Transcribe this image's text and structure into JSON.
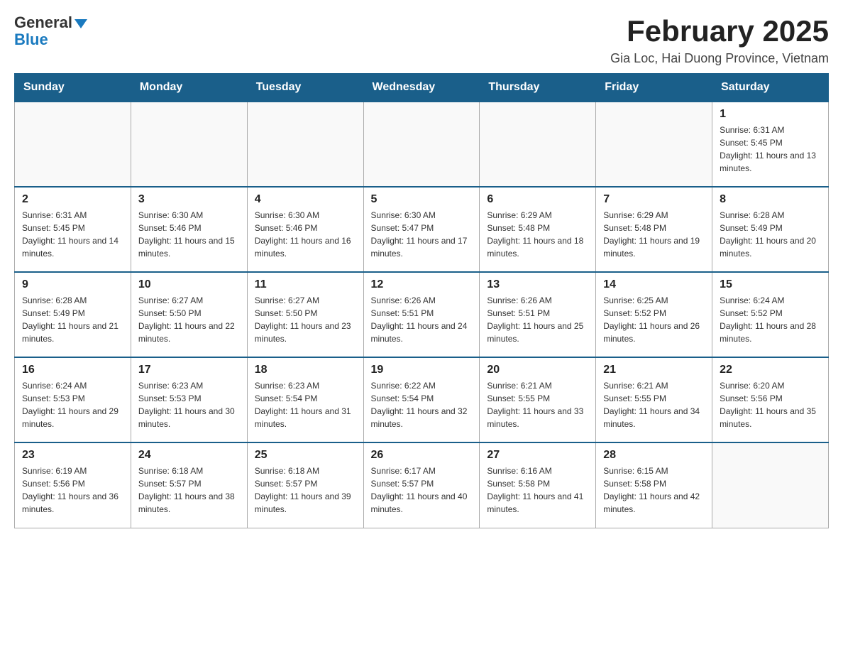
{
  "header": {
    "logo_general": "General",
    "logo_blue": "Blue",
    "month_title": "February 2025",
    "location": "Gia Loc, Hai Duong Province, Vietnam"
  },
  "weekdays": [
    "Sunday",
    "Monday",
    "Tuesday",
    "Wednesday",
    "Thursday",
    "Friday",
    "Saturday"
  ],
  "weeks": [
    [
      {
        "day": "",
        "sunrise": "",
        "sunset": "",
        "daylight": ""
      },
      {
        "day": "",
        "sunrise": "",
        "sunset": "",
        "daylight": ""
      },
      {
        "day": "",
        "sunrise": "",
        "sunset": "",
        "daylight": ""
      },
      {
        "day": "",
        "sunrise": "",
        "sunset": "",
        "daylight": ""
      },
      {
        "day": "",
        "sunrise": "",
        "sunset": "",
        "daylight": ""
      },
      {
        "day": "",
        "sunrise": "",
        "sunset": "",
        "daylight": ""
      },
      {
        "day": "1",
        "sunrise": "Sunrise: 6:31 AM",
        "sunset": "Sunset: 5:45 PM",
        "daylight": "Daylight: 11 hours and 13 minutes."
      }
    ],
    [
      {
        "day": "2",
        "sunrise": "Sunrise: 6:31 AM",
        "sunset": "Sunset: 5:45 PM",
        "daylight": "Daylight: 11 hours and 14 minutes."
      },
      {
        "day": "3",
        "sunrise": "Sunrise: 6:30 AM",
        "sunset": "Sunset: 5:46 PM",
        "daylight": "Daylight: 11 hours and 15 minutes."
      },
      {
        "day": "4",
        "sunrise": "Sunrise: 6:30 AM",
        "sunset": "Sunset: 5:46 PM",
        "daylight": "Daylight: 11 hours and 16 minutes."
      },
      {
        "day": "5",
        "sunrise": "Sunrise: 6:30 AM",
        "sunset": "Sunset: 5:47 PM",
        "daylight": "Daylight: 11 hours and 17 minutes."
      },
      {
        "day": "6",
        "sunrise": "Sunrise: 6:29 AM",
        "sunset": "Sunset: 5:48 PM",
        "daylight": "Daylight: 11 hours and 18 minutes."
      },
      {
        "day": "7",
        "sunrise": "Sunrise: 6:29 AM",
        "sunset": "Sunset: 5:48 PM",
        "daylight": "Daylight: 11 hours and 19 minutes."
      },
      {
        "day": "8",
        "sunrise": "Sunrise: 6:28 AM",
        "sunset": "Sunset: 5:49 PM",
        "daylight": "Daylight: 11 hours and 20 minutes."
      }
    ],
    [
      {
        "day": "9",
        "sunrise": "Sunrise: 6:28 AM",
        "sunset": "Sunset: 5:49 PM",
        "daylight": "Daylight: 11 hours and 21 minutes."
      },
      {
        "day": "10",
        "sunrise": "Sunrise: 6:27 AM",
        "sunset": "Sunset: 5:50 PM",
        "daylight": "Daylight: 11 hours and 22 minutes."
      },
      {
        "day": "11",
        "sunrise": "Sunrise: 6:27 AM",
        "sunset": "Sunset: 5:50 PM",
        "daylight": "Daylight: 11 hours and 23 minutes."
      },
      {
        "day": "12",
        "sunrise": "Sunrise: 6:26 AM",
        "sunset": "Sunset: 5:51 PM",
        "daylight": "Daylight: 11 hours and 24 minutes."
      },
      {
        "day": "13",
        "sunrise": "Sunrise: 6:26 AM",
        "sunset": "Sunset: 5:51 PM",
        "daylight": "Daylight: 11 hours and 25 minutes."
      },
      {
        "day": "14",
        "sunrise": "Sunrise: 6:25 AM",
        "sunset": "Sunset: 5:52 PM",
        "daylight": "Daylight: 11 hours and 26 minutes."
      },
      {
        "day": "15",
        "sunrise": "Sunrise: 6:24 AM",
        "sunset": "Sunset: 5:52 PM",
        "daylight": "Daylight: 11 hours and 28 minutes."
      }
    ],
    [
      {
        "day": "16",
        "sunrise": "Sunrise: 6:24 AM",
        "sunset": "Sunset: 5:53 PM",
        "daylight": "Daylight: 11 hours and 29 minutes."
      },
      {
        "day": "17",
        "sunrise": "Sunrise: 6:23 AM",
        "sunset": "Sunset: 5:53 PM",
        "daylight": "Daylight: 11 hours and 30 minutes."
      },
      {
        "day": "18",
        "sunrise": "Sunrise: 6:23 AM",
        "sunset": "Sunset: 5:54 PM",
        "daylight": "Daylight: 11 hours and 31 minutes."
      },
      {
        "day": "19",
        "sunrise": "Sunrise: 6:22 AM",
        "sunset": "Sunset: 5:54 PM",
        "daylight": "Daylight: 11 hours and 32 minutes."
      },
      {
        "day": "20",
        "sunrise": "Sunrise: 6:21 AM",
        "sunset": "Sunset: 5:55 PM",
        "daylight": "Daylight: 11 hours and 33 minutes."
      },
      {
        "day": "21",
        "sunrise": "Sunrise: 6:21 AM",
        "sunset": "Sunset: 5:55 PM",
        "daylight": "Daylight: 11 hours and 34 minutes."
      },
      {
        "day": "22",
        "sunrise": "Sunrise: 6:20 AM",
        "sunset": "Sunset: 5:56 PM",
        "daylight": "Daylight: 11 hours and 35 minutes."
      }
    ],
    [
      {
        "day": "23",
        "sunrise": "Sunrise: 6:19 AM",
        "sunset": "Sunset: 5:56 PM",
        "daylight": "Daylight: 11 hours and 36 minutes."
      },
      {
        "day": "24",
        "sunrise": "Sunrise: 6:18 AM",
        "sunset": "Sunset: 5:57 PM",
        "daylight": "Daylight: 11 hours and 38 minutes."
      },
      {
        "day": "25",
        "sunrise": "Sunrise: 6:18 AM",
        "sunset": "Sunset: 5:57 PM",
        "daylight": "Daylight: 11 hours and 39 minutes."
      },
      {
        "day": "26",
        "sunrise": "Sunrise: 6:17 AM",
        "sunset": "Sunset: 5:57 PM",
        "daylight": "Daylight: 11 hours and 40 minutes."
      },
      {
        "day": "27",
        "sunrise": "Sunrise: 6:16 AM",
        "sunset": "Sunset: 5:58 PM",
        "daylight": "Daylight: 11 hours and 41 minutes."
      },
      {
        "day": "28",
        "sunrise": "Sunrise: 6:15 AM",
        "sunset": "Sunset: 5:58 PM",
        "daylight": "Daylight: 11 hours and 42 minutes."
      },
      {
        "day": "",
        "sunrise": "",
        "sunset": "",
        "daylight": ""
      }
    ]
  ]
}
